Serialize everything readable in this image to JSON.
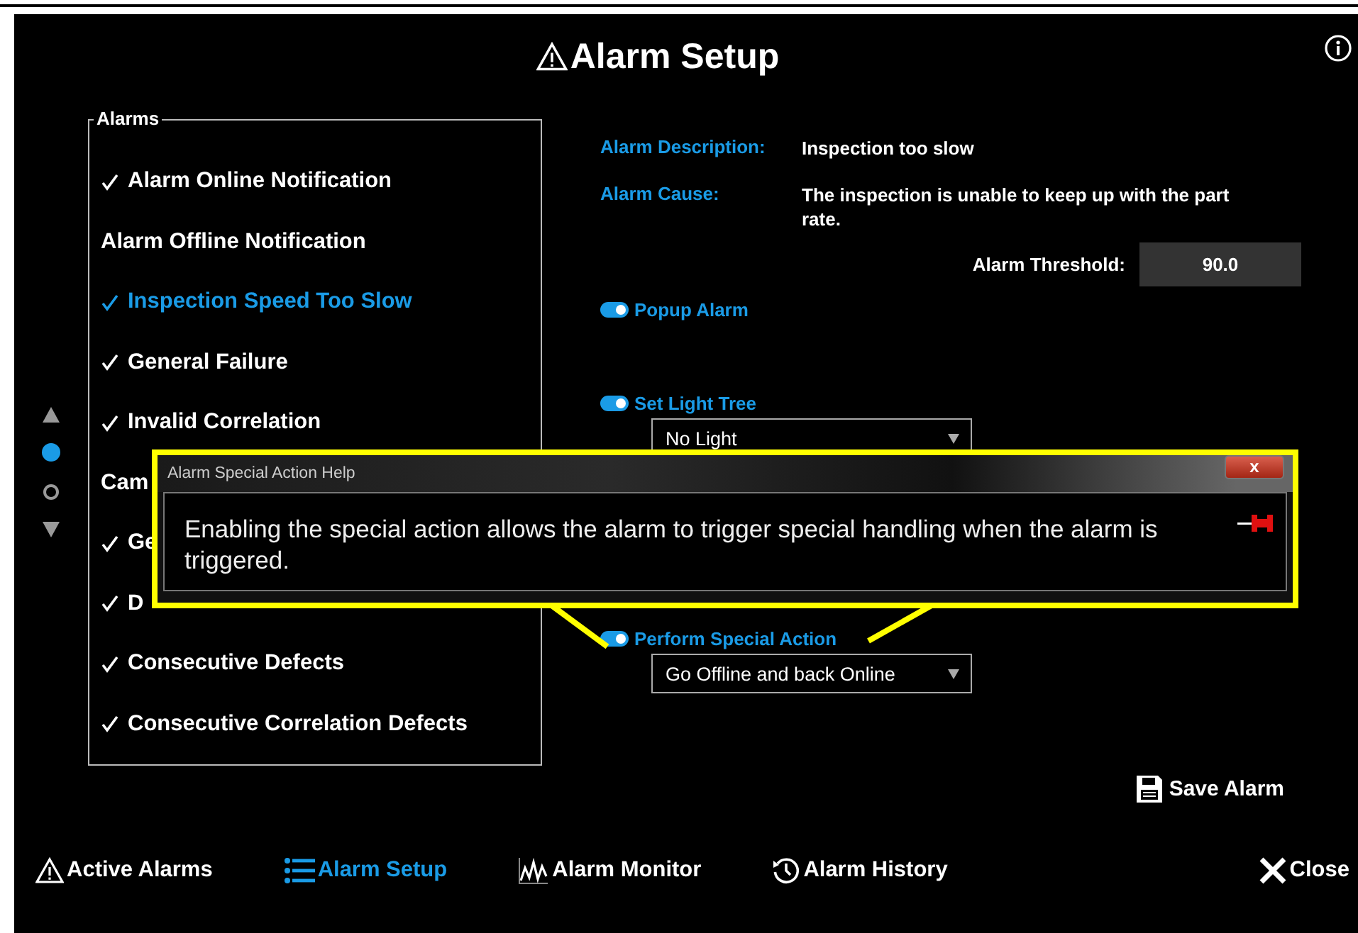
{
  "window": {
    "title": "Alarm Setup"
  },
  "pager": [
    {
      "kind": "up"
    },
    {
      "kind": "page",
      "selected": true
    },
    {
      "kind": "page",
      "selected": false
    },
    {
      "kind": "down"
    }
  ],
  "alarms": {
    "legend": "Alarms",
    "items": [
      {
        "label": "Alarm Online Notification",
        "checked": true,
        "selected": false
      },
      {
        "label": "Alarm Offline Notification",
        "checked": false,
        "selected": false
      },
      {
        "label": "Inspection Speed Too Slow",
        "checked": true,
        "selected": true
      },
      {
        "label": "General Failure",
        "checked": true,
        "selected": false
      },
      {
        "label": "Invalid Correlation",
        "checked": true,
        "selected": false
      },
      {
        "label": "Cam",
        "checked": false,
        "selected": false
      },
      {
        "label": "Ge",
        "checked": true,
        "selected": false
      },
      {
        "label": "D",
        "checked": true,
        "selected": false
      },
      {
        "label": "Consecutive Defects",
        "checked": true,
        "selected": false
      },
      {
        "label": "Consecutive Correlation Defects",
        "checked": true,
        "selected": false
      }
    ]
  },
  "details": {
    "description_label": "Alarm Description:",
    "description": "Inspection too slow",
    "cause_label": "Alarm Cause:",
    "cause": "The inspection is unable to keep up with the part rate.",
    "threshold_label": "Alarm Threshold:",
    "threshold": "90.0"
  },
  "options": [
    {
      "label": "Popup Alarm",
      "on": true
    },
    {
      "label": "Set Light Tree",
      "on": true,
      "dropdown": "No Light"
    },
    {
      "label": "Perform Special Action",
      "on": true,
      "dropdown": "Go Offline and back Online"
    }
  ],
  "save_button": "Save Alarm",
  "nav": [
    {
      "label": "Active Alarms",
      "kind": "warning",
      "selected": false
    },
    {
      "label": "Alarm Setup",
      "kind": "list",
      "selected": true
    },
    {
      "label": "Alarm Monitor",
      "kind": "chart",
      "selected": false
    },
    {
      "label": "Alarm History",
      "kind": "history",
      "selected": false
    }
  ],
  "close_button": "Close",
  "popup": {
    "title": "Alarm Special Action Help",
    "close": "x",
    "message": "Enabling the special action allows the alarm to trigger special handling when the alarm is triggered."
  }
}
